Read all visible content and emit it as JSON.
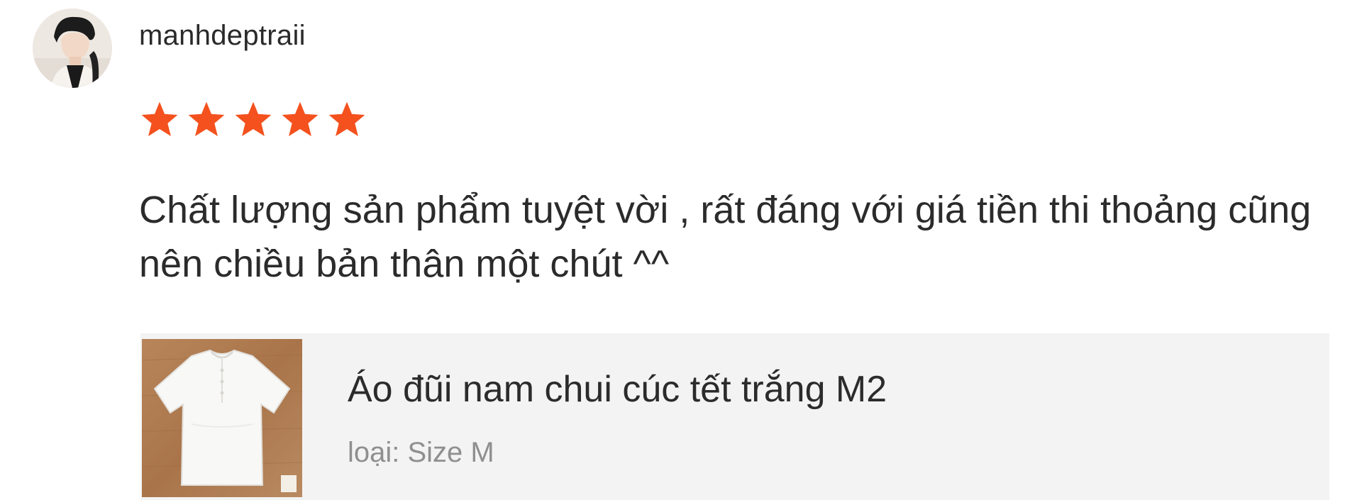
{
  "review": {
    "username": "manhdeptraii",
    "rating": {
      "value": 5,
      "max": 5,
      "star_color": "#f4511e"
    },
    "comment": "Chất lượng sản phẩm tuyệt vời , rất đáng với giá tiền thi thoảng cũng nên chiều bản thân một chút ^^",
    "product": {
      "name": "Áo đũi nam chui cúc tết trắng M2",
      "variant": "loại: Size M",
      "thumbnail_icon": "white-shirt-image"
    }
  },
  "colors": {
    "text": "#2b2b2b",
    "muted_text": "#8f8f8f",
    "card_background": "#f3f3f3",
    "star": "#f4511e"
  }
}
